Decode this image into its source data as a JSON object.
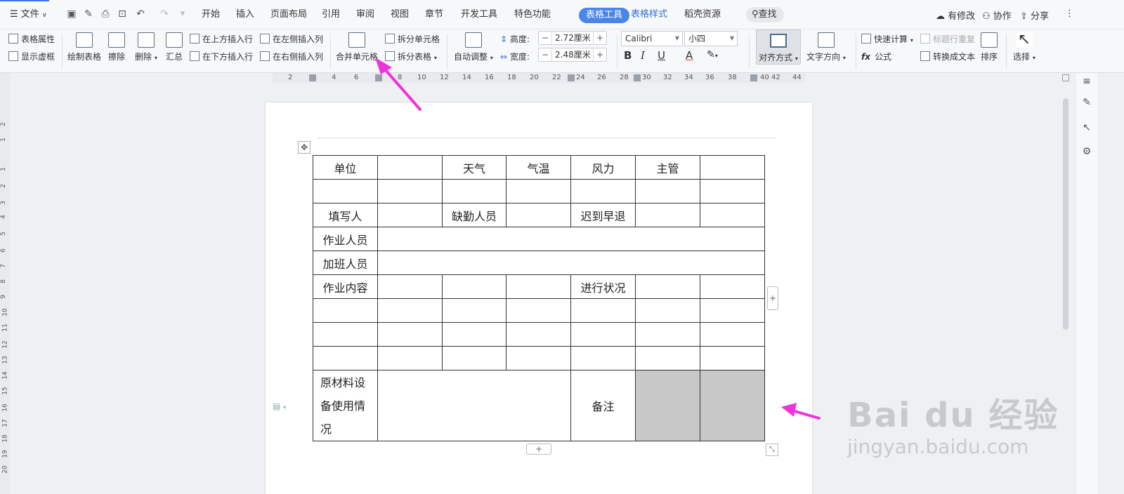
{
  "menubar": {
    "file": "文件",
    "tabs": [
      "开始",
      "插入",
      "页面布局",
      "引用",
      "审阅",
      "视图",
      "章节",
      "开发工具",
      "特色功能"
    ],
    "active_tab": "表格工具",
    "tab_table_style": "表格样式",
    "tab_resources": "稻壳资源",
    "search": "查找",
    "has_changes": "有修改",
    "collaborate": "协作",
    "share": "分享"
  },
  "ribbon": {
    "table_props": "表格属性",
    "show_gridlines": "显示虚框",
    "draw_table": "绘制表格",
    "erase": "擦除",
    "delete": "删除",
    "summary": "汇总",
    "insert_above": "在上方插入行",
    "insert_below": "在下方插入行",
    "insert_left": "在左侧插入列",
    "insert_right": "在右侧插入列",
    "merge_cells": "合并单元格",
    "split_cells": "拆分单元格",
    "split_table": "拆分表格",
    "auto_fit": "自动调整",
    "height_label": "高度:",
    "height_value": "2.72厘米",
    "width_label": "宽度:",
    "width_value": "2.48厘米",
    "font_name": "Calibri",
    "font_size": "小四",
    "bold": "B",
    "italic": "I",
    "underline": "U",
    "font_color": "A",
    "align": "对齐方式",
    "text_direction": "文字方向",
    "quick_calc": "快速计算",
    "repeat_header": "标题行重复",
    "formula": "公式",
    "to_text": "转换成文本",
    "sort": "排序",
    "select": "选择"
  },
  "ruler": {
    "ticks": [
      "2",
      "4",
      "6",
      "8",
      "10",
      "12",
      "14",
      "16",
      "18",
      "20",
      "22",
      "24",
      "26",
      "28",
      "30",
      "32",
      "34",
      "36",
      "38",
      "40",
      "42",
      "44"
    ]
  },
  "vruler": {
    "ticks": [
      "2",
      "1",
      "1",
      "2",
      "3",
      "4",
      "5",
      "6",
      "7",
      "8",
      "9",
      "10",
      "11",
      "12",
      "13",
      "14",
      "15",
      "16",
      "17",
      "18",
      "19",
      "20"
    ]
  },
  "table": {
    "r1": [
      "单位",
      "",
      "天气",
      "气温",
      "风力",
      "主管",
      ""
    ],
    "r3": [
      "填写人",
      "",
      "缺勤人员",
      "",
      "迟到早退",
      "",
      ""
    ],
    "r4": "作业人员",
    "r5": "加班人员",
    "r6": [
      "作业内容",
      "",
      "",
      "",
      "进行状况",
      "",
      ""
    ],
    "r10_label": "原材料设备使用情况",
    "r10_note": "备注"
  },
  "watermark": {
    "main": "Bai  du 经验",
    "sub": "jingyan.baidu.com"
  },
  "colors": {
    "accent": "#4a86e8",
    "arrow": "#ee33dd",
    "selected_cell": "#c8c8c8"
  }
}
